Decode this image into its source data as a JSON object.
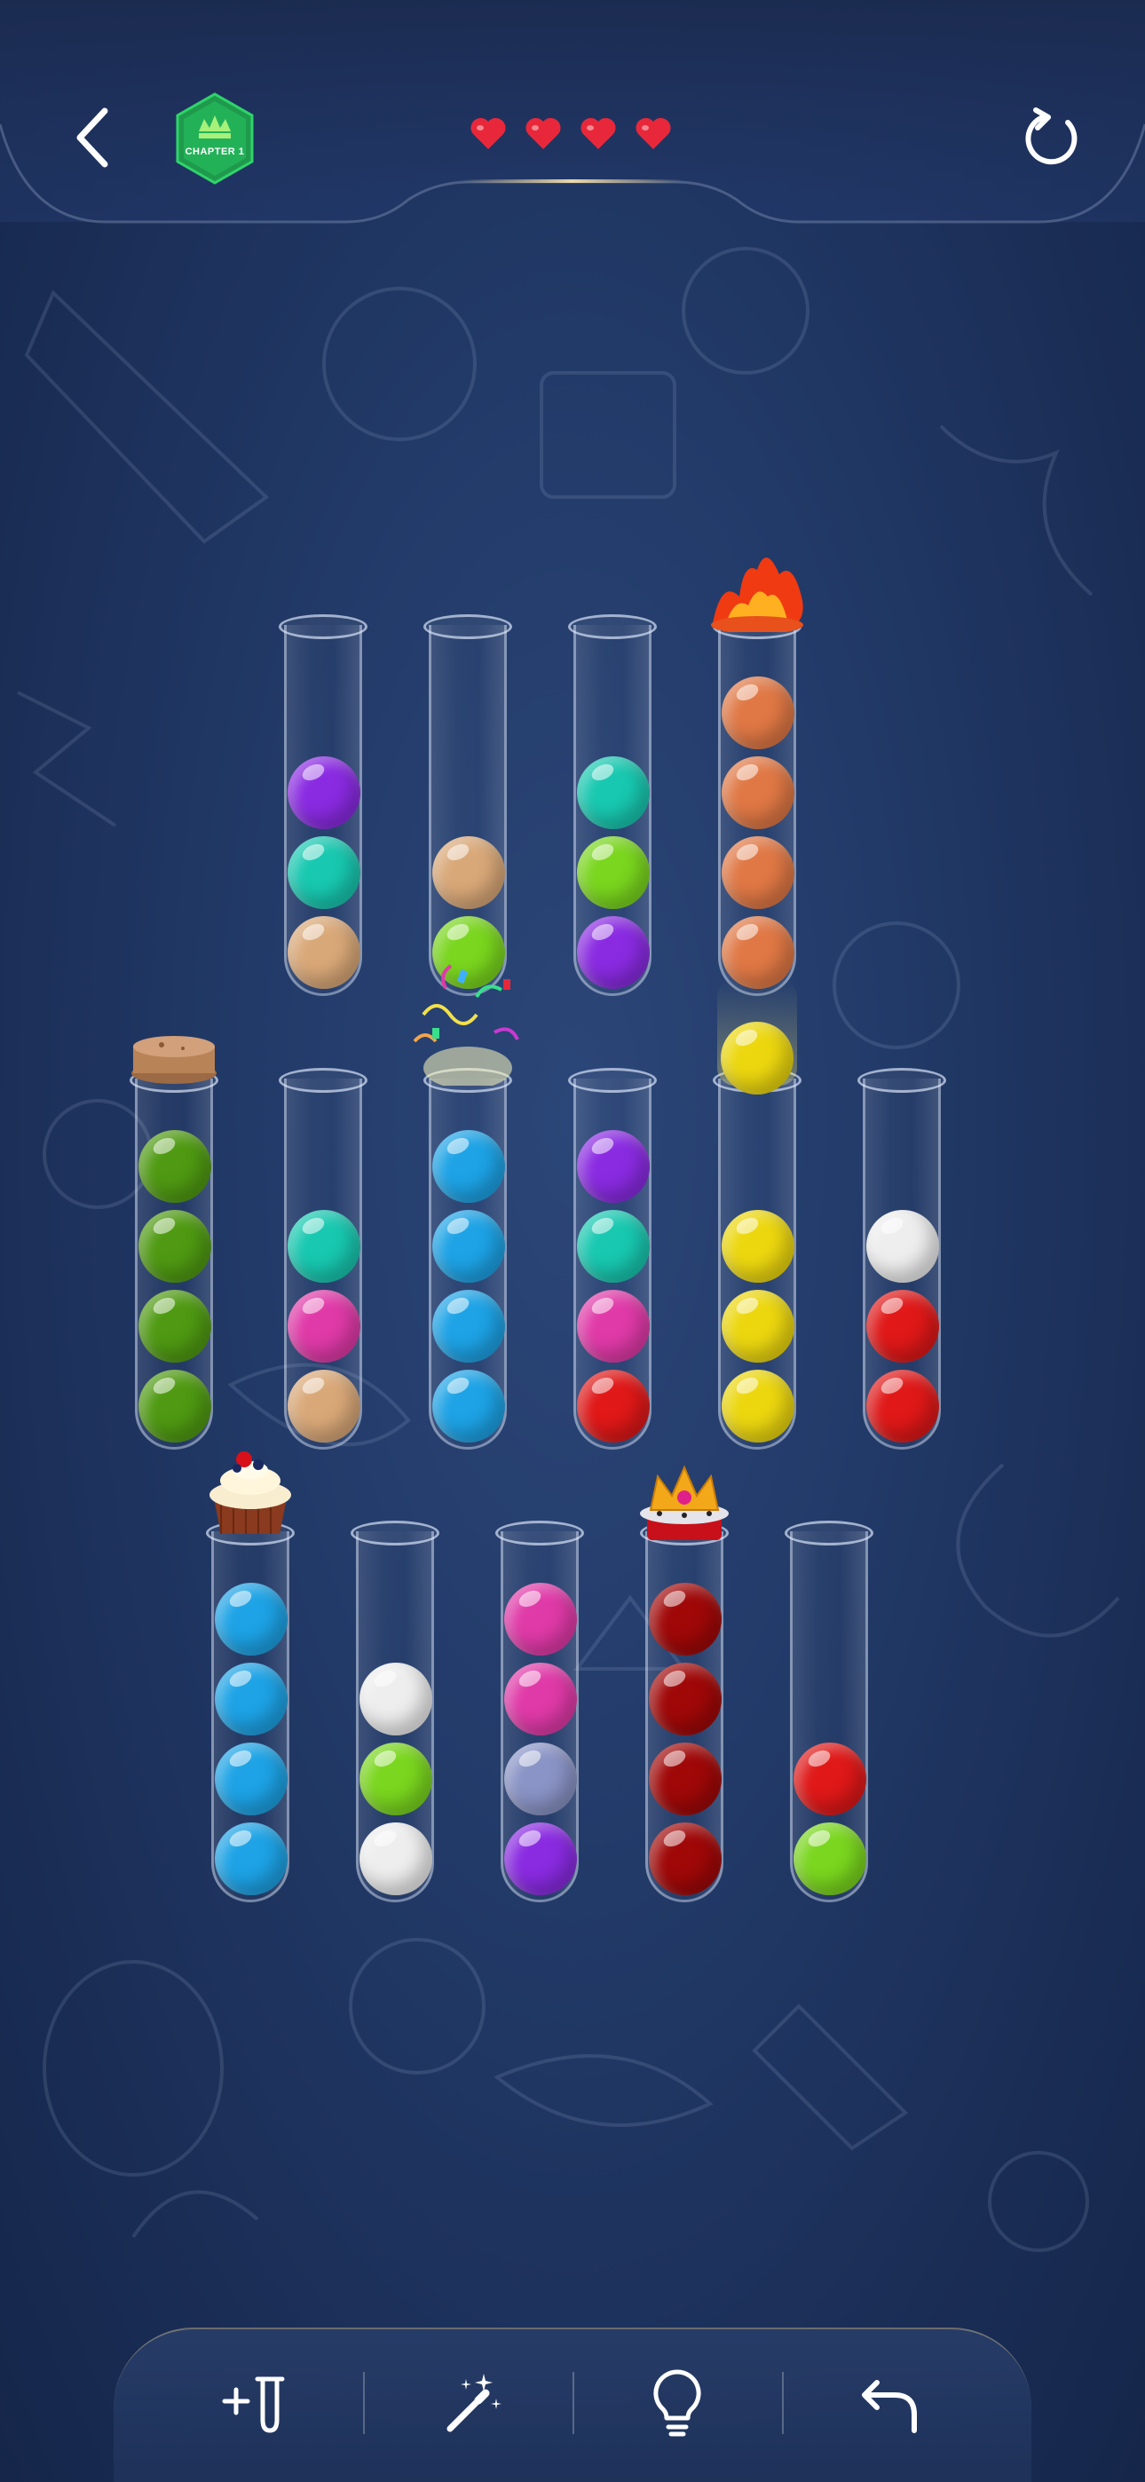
{
  "header": {
    "chapter_label": "CHAPTER 1",
    "lives": 4
  },
  "colors": {
    "purple": "#8a2be2",
    "teal": "#18c8b0",
    "tan": "#d9a878",
    "lime": "#7ad61e",
    "orange": "#e07845",
    "green": "#4f9a12",
    "blue": "#1da3e6",
    "magenta": "#e03aa8",
    "red": "#e01818",
    "yellow": "#ecd70f",
    "white": "#eeeeee",
    "darkred": "#a00808",
    "slate": "#8a94c6",
    "heart": "#e8283a"
  },
  "tubes": [
    {
      "row": 1,
      "decoration": "",
      "balls": [
        "purple",
        "teal",
        "tan"
      ]
    },
    {
      "row": 1,
      "decoration": "",
      "balls": [
        "tan",
        "lime"
      ]
    },
    {
      "row": 1,
      "decoration": "",
      "balls": [
        "teal",
        "lime",
        "purple"
      ]
    },
    {
      "row": 1,
      "decoration": "fire",
      "balls": [
        "orange",
        "orange",
        "orange",
        "orange"
      ]
    },
    {
      "row": 2,
      "decoration": "cork",
      "balls": [
        "green",
        "green",
        "green",
        "green"
      ]
    },
    {
      "row": 2,
      "decoration": "",
      "balls": [
        "teal",
        "magenta",
        "tan"
      ]
    },
    {
      "row": 2,
      "decoration": "confetti",
      "balls": [
        "blue",
        "blue",
        "blue",
        "blue"
      ]
    },
    {
      "row": 2,
      "decoration": "",
      "balls": [
        "purple",
        "teal",
        "magenta",
        "red"
      ]
    },
    {
      "row": 2,
      "decoration": "lifted-ball",
      "lifted": "yellow",
      "balls": [
        "yellow",
        "yellow",
        "yellow"
      ]
    },
    {
      "row": 2,
      "decoration": "",
      "balls": [
        "white",
        "red",
        "red"
      ]
    },
    {
      "row": 3,
      "decoration": "cupcake",
      "balls": [
        "blue",
        "blue",
        "blue",
        "blue"
      ]
    },
    {
      "row": 3,
      "decoration": "",
      "balls": [
        "white",
        "lime",
        "white"
      ]
    },
    {
      "row": 3,
      "decoration": "",
      "balls": [
        "magenta",
        "magenta",
        "slate",
        "purple"
      ]
    },
    {
      "row": 3,
      "decoration": "crown",
      "balls": [
        "darkred",
        "darkred",
        "darkred",
        "darkred"
      ]
    },
    {
      "row": 3,
      "decoration": "",
      "balls": [
        "red",
        "lime"
      ]
    }
  ],
  "toolbar": {
    "items": [
      {
        "name": "add-tube",
        "icon": "add-tube-icon"
      },
      {
        "name": "magic-wand",
        "icon": "magic-wand-icon"
      },
      {
        "name": "hint",
        "icon": "lightbulb-icon"
      },
      {
        "name": "undo",
        "icon": "undo-icon"
      }
    ]
  }
}
